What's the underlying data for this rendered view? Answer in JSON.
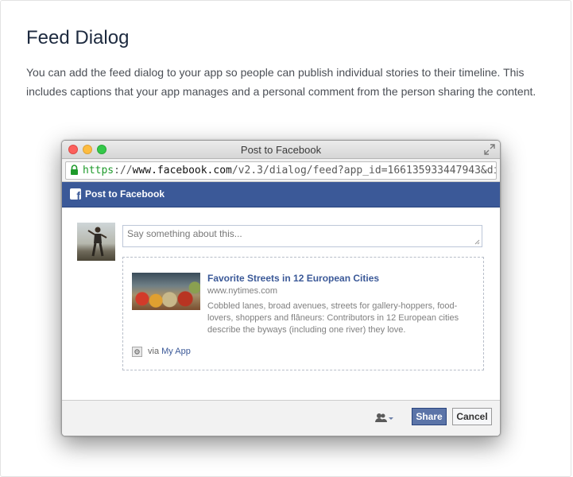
{
  "page": {
    "heading": "Feed Dialog",
    "description": "You can add the feed dialog to your app so people can publish individual stories to their timeline. This includes captions that your app manages and a personal comment from the person sharing the content."
  },
  "window": {
    "title": "Post to Facebook",
    "url_scheme": "https",
    "url_sep": "://",
    "url_domain": "www.facebook.com",
    "url_path": "/v2.3/dialog/feed?app_id=166135933447943&di..."
  },
  "dialog": {
    "header_title": "Post to Facebook",
    "comment_placeholder": "Say something about this...",
    "preview": {
      "title": "Favorite Streets in 12 European Cities",
      "domain": "www.nytimes.com",
      "description": "Cobbled lanes, broad avenues, streets for gallery-hoppers, food-lovers, shoppers and flâneurs: Contributors in 12 European cities describe the byways (including one river) they love."
    },
    "via_prefix": "via",
    "app_name": "My App",
    "share_label": "Share",
    "cancel_label": "Cancel"
  },
  "colors": {
    "facebook_blue": "#3b5998",
    "secure_green": "#1e9a2b"
  }
}
